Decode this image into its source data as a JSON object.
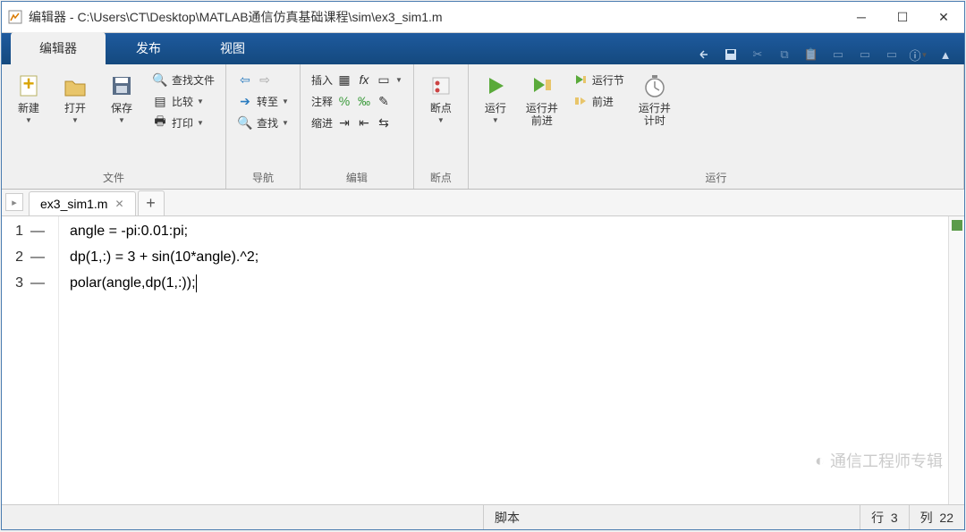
{
  "window": {
    "title": "编辑器 - C:\\Users\\CT\\Desktop\\MATLAB通信仿真基础课程\\sim\\ex3_sim1.m"
  },
  "tabs": [
    {
      "label": "编辑器",
      "active": true
    },
    {
      "label": "发布",
      "active": false
    },
    {
      "label": "视图",
      "active": false
    }
  ],
  "ribbon": {
    "file": {
      "label": "文件",
      "new": "新建",
      "open": "打开",
      "save": "保存",
      "findfiles": "查找文件",
      "compare": "比较",
      "print": "打印"
    },
    "nav": {
      "label": "导航",
      "goto": "转至",
      "find": "查找"
    },
    "edit": {
      "label": "编辑",
      "insert": "插入",
      "comment": "注释",
      "indent": "缩进"
    },
    "breakpoints": {
      "label": "断点",
      "breakpoint": "断点"
    },
    "run": {
      "label": "运行",
      "run": "运行",
      "runadvance": "运行并\n前进",
      "runsection": "运行节",
      "advance": "前进",
      "runtime": "运行并\n计时"
    }
  },
  "filetab": {
    "name": "ex3_sim1.m"
  },
  "code": {
    "lines": [
      {
        "num": "1",
        "text": "angle = -pi:0.01:pi;"
      },
      {
        "num": "2",
        "text": "dp(1,:) = 3 + sin(10*angle).^2;"
      },
      {
        "num": "3",
        "text": "polar(angle,dp(1,:));"
      }
    ]
  },
  "status": {
    "type": "脚本",
    "line_lbl": "行",
    "line": "3",
    "col_lbl": "列",
    "col": "22"
  },
  "watermark": "通信工程师专辑"
}
